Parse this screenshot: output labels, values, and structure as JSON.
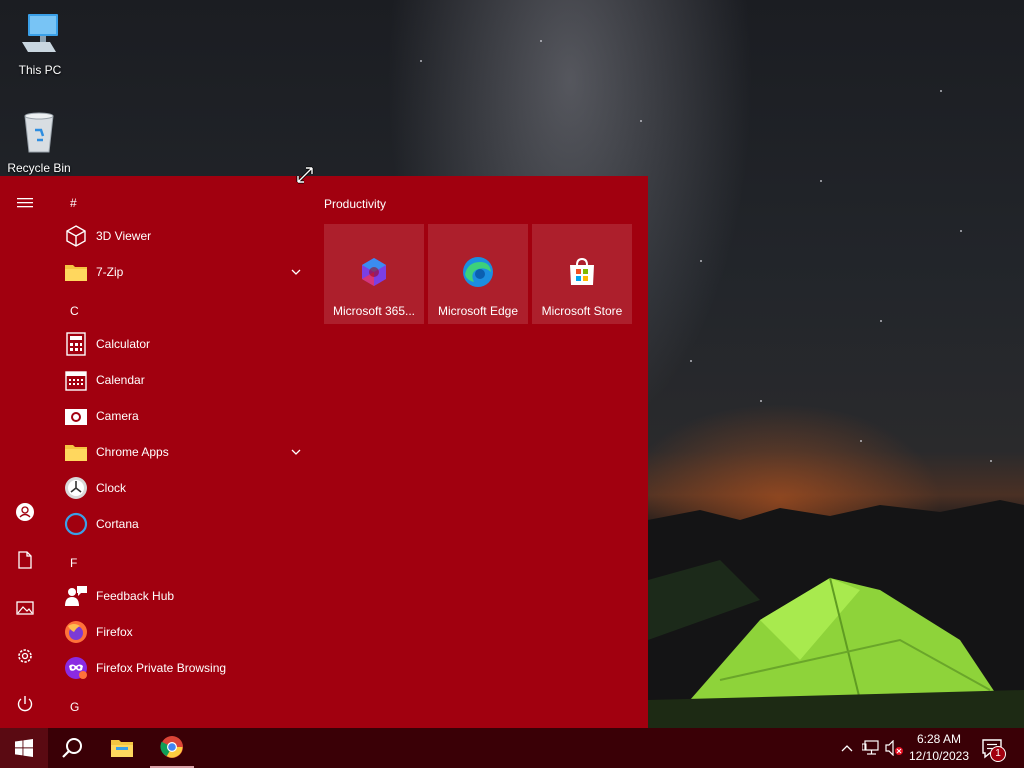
{
  "desktop": {
    "icons": [
      {
        "label": "This PC",
        "icon": "this-pc-icon"
      },
      {
        "label": "Recycle Bin",
        "icon": "recycle-bin-icon"
      }
    ]
  },
  "start_menu": {
    "accent": "#a1000f",
    "app_list": [
      {
        "type": "letter",
        "label": "#"
      },
      {
        "type": "app",
        "label": "3D Viewer",
        "icon": "cube-icon"
      },
      {
        "type": "app",
        "label": "7-Zip",
        "icon": "folder-icon",
        "expandable": true
      },
      {
        "type": "letter",
        "label": "C"
      },
      {
        "type": "app",
        "label": "Calculator",
        "icon": "calculator-icon"
      },
      {
        "type": "app",
        "label": "Calendar",
        "icon": "calendar-icon"
      },
      {
        "type": "app",
        "label": "Camera",
        "icon": "camera-icon"
      },
      {
        "type": "app",
        "label": "Chrome Apps",
        "icon": "folder-icon",
        "expandable": true
      },
      {
        "type": "app",
        "label": "Clock",
        "icon": "clock-icon"
      },
      {
        "type": "app",
        "label": "Cortana",
        "icon": "cortana-icon"
      },
      {
        "type": "letter",
        "label": "F"
      },
      {
        "type": "app",
        "label": "Feedback Hub",
        "icon": "feedback-hub-icon"
      },
      {
        "type": "app",
        "label": "Firefox",
        "icon": "firefox-icon"
      },
      {
        "type": "app",
        "label": "Firefox Private Browsing",
        "icon": "firefox-private-icon"
      },
      {
        "type": "letter",
        "label": "G"
      }
    ],
    "tiles_group_title": "Productivity",
    "tiles": [
      {
        "label": "Microsoft 365...",
        "icon": "microsoft-365-icon"
      },
      {
        "label": "Microsoft Edge",
        "icon": "edge-icon"
      },
      {
        "label": "Microsoft Store",
        "icon": "store-icon"
      }
    ]
  },
  "taskbar": {
    "time": "6:28 AM",
    "date": "12/10/2023",
    "notification_count": "1"
  }
}
